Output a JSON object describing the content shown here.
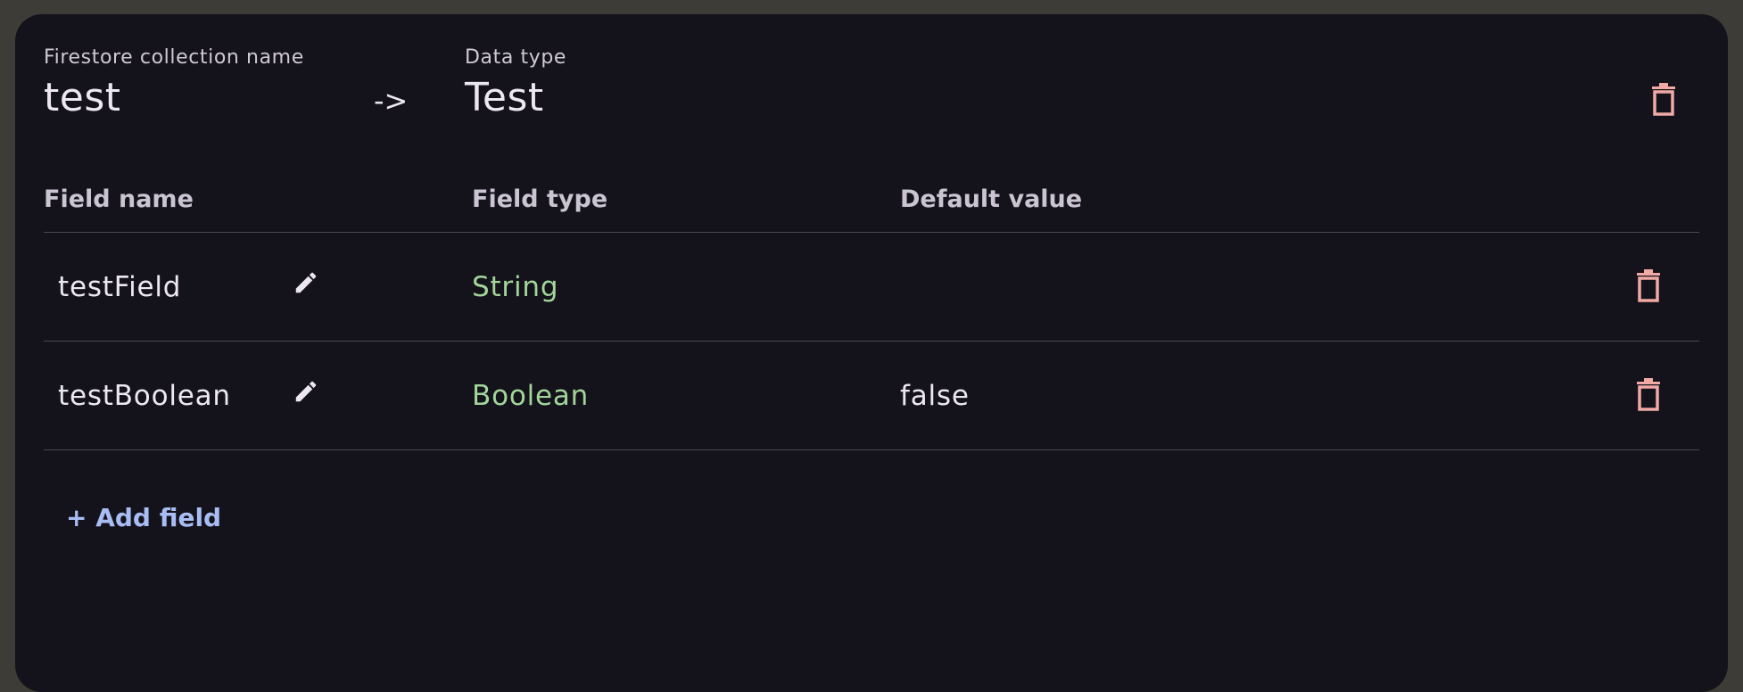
{
  "header": {
    "collection_label": "Firestore collection name",
    "collection_value": "test",
    "arrow": "->",
    "datatype_label": "Data type",
    "datatype_value": "Test"
  },
  "table": {
    "columns": [
      "Field name",
      "Field type",
      "Default value"
    ],
    "rows": [
      {
        "name": "testField",
        "type": "String",
        "default": ""
      },
      {
        "name": "testBoolean",
        "type": "Boolean",
        "default": "false"
      }
    ]
  },
  "actions": {
    "add_field_label": "+ Add field"
  },
  "icons": {
    "delete": "trash-icon",
    "edit": "pencil-icon"
  },
  "colors": {
    "background": "#14121a",
    "type_text": "#a2d59a",
    "delete_icon": "#f0a9a4",
    "add_link": "#a9bdf5"
  }
}
